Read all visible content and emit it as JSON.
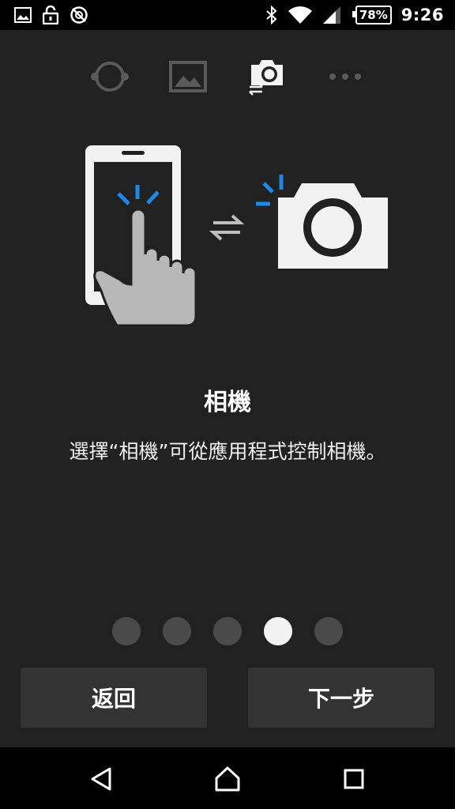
{
  "status_bar": {
    "icons": [
      "image-icon",
      "lock-open-icon",
      "sync-disabled-icon"
    ],
    "right_icons": [
      "bluetooth-icon",
      "wifi-icon",
      "signal-icon"
    ],
    "battery": "78%",
    "time": "9:26"
  },
  "mode_tabs": [
    "sync-icon",
    "gallery-icon",
    "camera-remote-icon",
    "more-icon"
  ],
  "active_mode": "camera-remote-icon",
  "content": {
    "title": "相機",
    "description": "選擇“相機”可從應用程式控制相機。"
  },
  "pager": {
    "total": 5,
    "active_index": 3
  },
  "buttons": {
    "back": "返回",
    "next": "下一步"
  },
  "colors": {
    "accent_blue": "#1e88e5",
    "background": "#212121",
    "button": "#333333"
  },
  "nav": [
    "back-icon",
    "home-icon",
    "recents-icon"
  ]
}
